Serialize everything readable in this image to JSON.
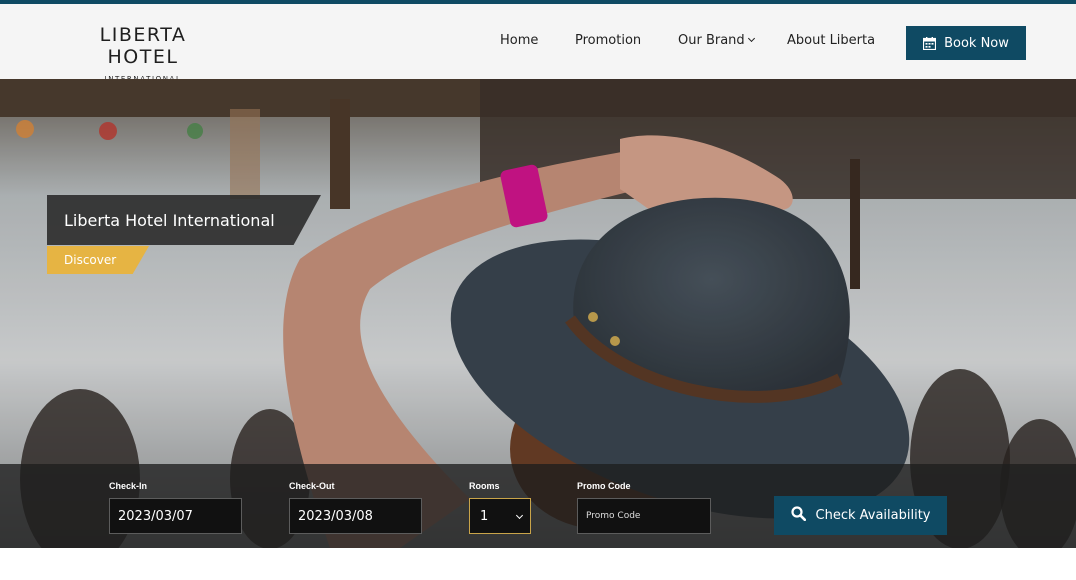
{
  "header": {
    "logo_main": "LIBERTA HOTEL",
    "logo_sub": "INTERNATIONAL",
    "nav": {
      "home": "Home",
      "promotion": "Promotion",
      "our_brand": "Our Brand",
      "about": "About Liberta"
    },
    "book_now": "Book Now",
    "book_icon": "calendar-icon"
  },
  "hero": {
    "title": "Liberta Hotel International",
    "discover": "Discover"
  },
  "booking": {
    "checkin_label": "Check-In",
    "checkin_value": "2023/03/07",
    "checkout_label": "Check-Out",
    "checkout_value": "2023/03/08",
    "rooms_label": "Rooms",
    "rooms_value": "1",
    "promo_label": "Promo Code",
    "promo_placeholder": "Promo Code",
    "check_button": "Check Availability",
    "check_icon": "search-icon"
  },
  "colors": {
    "brand_blue": "#0f4a63",
    "accent_gold": "#e6b443",
    "header_bg": "#f5f5f5"
  }
}
